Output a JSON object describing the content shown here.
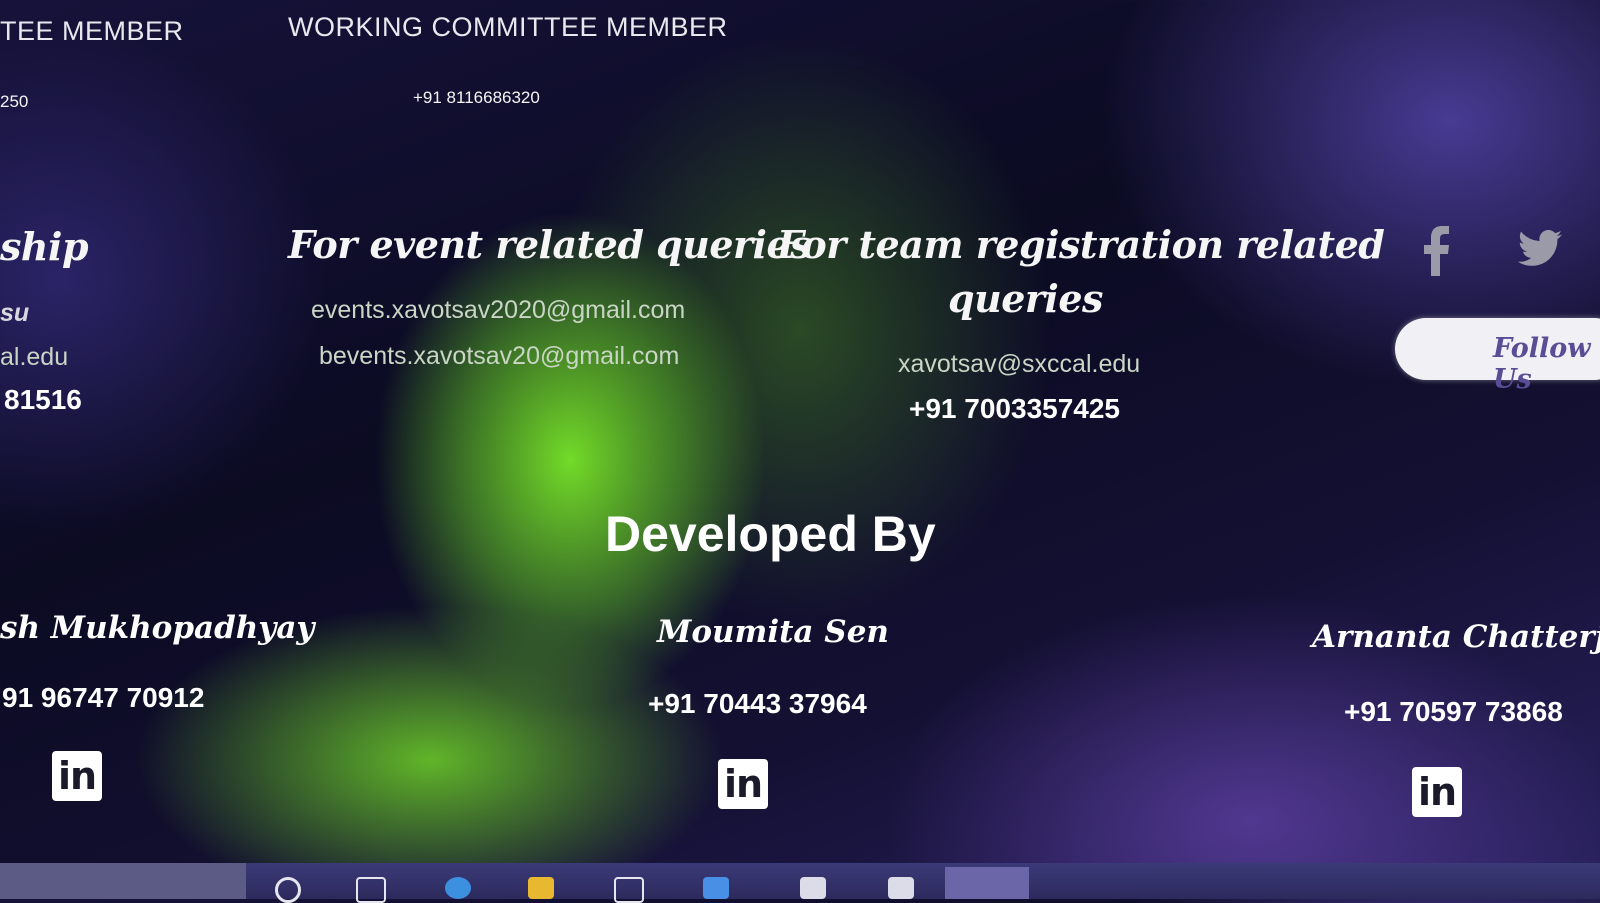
{
  "committee": {
    "left_role": "TEE MEMBER",
    "left_phone": "250",
    "right_role": "WORKING COMMITTEE MEMBER",
    "right_phone": "+91 8116686320"
  },
  "sponsorship": {
    "heading": "ship",
    "name": "su",
    "email": "al.edu",
    "phone": "81516"
  },
  "event_queries": {
    "heading": "For event related queries",
    "email1": "events.xavotsav2020@gmail.com",
    "email2": "bevents.xavotsav20@gmail.com"
  },
  "team_queries": {
    "heading_line1": "For team registration related",
    "heading_line2": "queries",
    "email": "xavotsav@sxccal.edu",
    "phone": "+91 7003357425"
  },
  "social": {
    "facebook_icon": "facebook-icon",
    "twitter_icon": "twitter-icon",
    "follow_label": "Follow Us"
  },
  "developed_by": {
    "title": "Developed By",
    "devs": [
      {
        "name": "sh Mukhopadhyay",
        "phone": "91 96747 70912",
        "icon": "linkedin-icon",
        "icon_text": "in"
      },
      {
        "name": "Moumita Sen",
        "phone": "+91 70443 37964",
        "icon": "linkedin-icon",
        "icon_text": "in"
      },
      {
        "name": "Arnanta Chatterjee",
        "phone": "+91 70597 73868",
        "icon": "linkedin-icon",
        "icon_text": "in"
      }
    ]
  },
  "colors": {
    "accent_green": "#78e628",
    "accent_purple": "#6e5adc",
    "follow_text": "#5a4c95"
  }
}
